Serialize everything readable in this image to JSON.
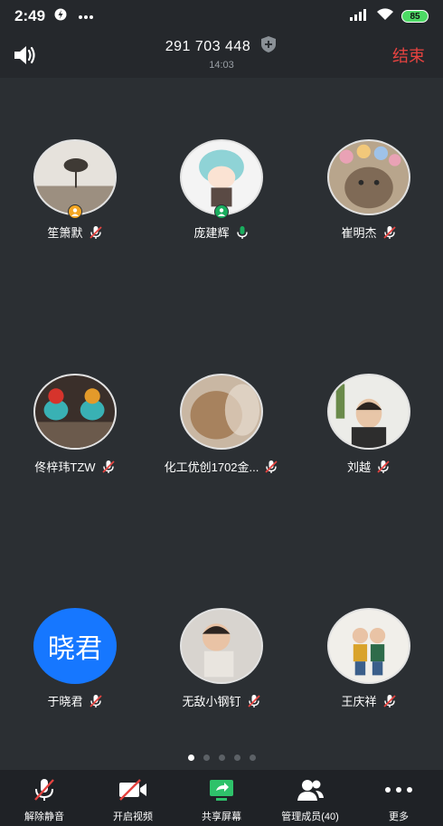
{
  "status_bar": {
    "time": "2:49",
    "battery": "85"
  },
  "header": {
    "meeting_id": "291 703 448",
    "duration": "14:03",
    "end_label": "结束"
  },
  "participants": [
    {
      "name": "笙箫默",
      "mic": "muted",
      "badge": "host"
    },
    {
      "name": "庞建辉",
      "mic": "active",
      "badge": "cohost"
    },
    {
      "name": "崔明杰",
      "mic": "muted",
      "badge": ""
    },
    {
      "name": "佟梓玮TZW",
      "mic": "muted",
      "badge": ""
    },
    {
      "name": "化工优创1702金...",
      "mic": "muted",
      "badge": ""
    },
    {
      "name": "刘越",
      "mic": "muted",
      "badge": ""
    },
    {
      "name": "于晓君",
      "mic": "muted",
      "badge": "",
      "avatar_text": "晓君"
    },
    {
      "name": "无敌小钢钉",
      "mic": "muted",
      "badge": ""
    },
    {
      "name": "王庆祥",
      "mic": "muted",
      "badge": ""
    }
  ],
  "pagination": {
    "pages": 5,
    "current": 1
  },
  "toolbar": {
    "unmute": "解除静音",
    "start_video": "开启视频",
    "share_screen": "共享屏幕",
    "manage_members": "管理成员(40)",
    "more": "更多"
  },
  "colors": {
    "background": "#2b2f33",
    "end_red": "#e64340",
    "share_green": "#2ec26a",
    "text_avatar_blue": "#1677ff",
    "host_orange": "#f5a623",
    "cohost_green": "#1aad5e"
  }
}
